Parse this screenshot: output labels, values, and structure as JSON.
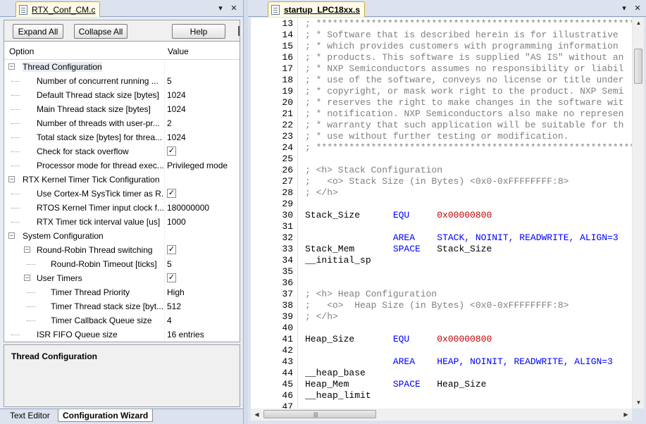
{
  "left": {
    "tab_title": "RTX_Conf_CM.c",
    "pin_glyph": "▾",
    "close_glyph": "✕",
    "toolbar": {
      "expand_all": "Expand All",
      "collapse_all": "Collapse All",
      "help": "Help"
    },
    "columns": {
      "option": "Option",
      "value": "Value"
    },
    "tree": [
      {
        "label": "Thread Configuration",
        "value": "",
        "level": 0,
        "expander": "−"
      },
      {
        "label": "Number of concurrent running ...",
        "value": "5",
        "level": 1
      },
      {
        "label": "Default Thread stack size [bytes]",
        "value": "1024",
        "level": 1
      },
      {
        "label": "Main Thread stack size [bytes]",
        "value": "1024",
        "level": 1
      },
      {
        "label": "Number of threads with user-pr...",
        "value": "2",
        "level": 1
      },
      {
        "label": "Total stack size [bytes] for threa...",
        "value": "1024",
        "level": 1
      },
      {
        "label": "Check for stack overflow",
        "check": "✓",
        "level": 1
      },
      {
        "label": "Processor mode for thread exec...",
        "value": "Privileged mode",
        "level": 1
      },
      {
        "label": "RTX Kernel Timer Tick Configuration",
        "value": "",
        "level": 0,
        "expander": "−"
      },
      {
        "label": "Use Cortex-M SysTick timer as R...",
        "check": "✓",
        "level": 1
      },
      {
        "label": "RTOS Kernel Timer input clock f...",
        "value": "180000000",
        "level": 1
      },
      {
        "label": "RTX Timer tick interval value [us]",
        "value": "1000",
        "level": 1
      },
      {
        "label": "System Configuration",
        "value": "",
        "level": 0,
        "expander": "−"
      },
      {
        "label": "Round-Robin Thread switching",
        "check": "✓",
        "level": 1,
        "expander": "−"
      },
      {
        "label": "Round-Robin Timeout [ticks]",
        "value": "5",
        "level": 2
      },
      {
        "label": "User Timers",
        "check": "✓",
        "level": 1,
        "expander": "−"
      },
      {
        "label": "Timer Thread Priority",
        "value": "High",
        "level": 2
      },
      {
        "label": "Timer Thread stack size [byt...",
        "value": "512",
        "level": 2
      },
      {
        "label": "Timer Callback Queue size",
        "value": "4",
        "level": 2
      },
      {
        "label": "ISR FIFO Queue size",
        "value": "16 entries",
        "level": 1
      }
    ],
    "description_title": "Thread Configuration",
    "bottom_tabs": {
      "text_editor": "Text Editor",
      "config_wizard": "Configuration Wizard"
    }
  },
  "right": {
    "tab_title": "startup_LPC18xx.s",
    "pin_glyph": "▾",
    "close_glyph": "✕",
    "line_numbers": [
      "13",
      "14",
      "15",
      "16",
      "17",
      "18",
      "19",
      "20",
      "21",
      "22",
      "23",
      "24",
      "25",
      "26",
      "27",
      "28",
      "29",
      "30",
      "31",
      "32",
      "33",
      "34",
      "35",
      "36",
      "37",
      "38",
      "39",
      "40",
      "41",
      "42",
      "43",
      "44",
      "45",
      "46",
      "47"
    ],
    "code": [
      [
        {
          "t": "; ****************************************************************",
          "c": "cm"
        }
      ],
      [
        {
          "t": "; * Software that is described herein is for illustrative",
          "c": "cm"
        }
      ],
      [
        {
          "t": "; * which provides customers with programming information",
          "c": "cm"
        }
      ],
      [
        {
          "t": "; * products. This software is supplied \"AS IS\" without an",
          "c": "cm"
        }
      ],
      [
        {
          "t": "; * NXP Semiconductors assumes no responsibility or liabil",
          "c": "cm"
        }
      ],
      [
        {
          "t": "; * use of the software, conveys no license or title under",
          "c": "cm"
        }
      ],
      [
        {
          "t": "; * copyright, or mask work right to the product. NXP Semi",
          "c": "cm"
        }
      ],
      [
        {
          "t": "; * reserves the right to make changes in the software wit",
          "c": "cm"
        }
      ],
      [
        {
          "t": "; * notification. NXP Semiconductors also make no represen",
          "c": "cm"
        }
      ],
      [
        {
          "t": "; * warranty that such application will be suitable for th",
          "c": "cm"
        }
      ],
      [
        {
          "t": "; * use without further testing or modification.",
          "c": "cm"
        }
      ],
      [
        {
          "t": "; ****************************************************************",
          "c": "cm"
        }
      ],
      [],
      [
        {
          "t": "; <h> Stack Configuration",
          "c": "cm"
        }
      ],
      [
        {
          "t": ";   <o> Stack Size (in Bytes) <0x0-0xFFFFFFFF:8>",
          "c": "cm"
        }
      ],
      [
        {
          "t": "; </h>",
          "c": "cm"
        }
      ],
      [],
      [
        {
          "t": "Stack_Size      ",
          "c": "id"
        },
        {
          "t": "EQU",
          "c": "kw"
        },
        {
          "t": "     ",
          "c": "id"
        },
        {
          "t": "0x00000800",
          "c": "num"
        }
      ],
      [],
      [
        {
          "t": "                ",
          "c": "id"
        },
        {
          "t": "AREA",
          "c": "kw"
        },
        {
          "t": "    ",
          "c": "id"
        },
        {
          "t": "STACK, NOINIT, READWRITE, ALIGN=3",
          "c": "kw"
        }
      ],
      [
        {
          "t": "Stack_Mem       ",
          "c": "id"
        },
        {
          "t": "SPACE",
          "c": "kw"
        },
        {
          "t": "   Stack_Size",
          "c": "id"
        }
      ],
      [
        {
          "t": "__initial_sp",
          "c": "id"
        }
      ],
      [],
      [],
      [
        {
          "t": "; <h> Heap Configuration",
          "c": "cm"
        }
      ],
      [
        {
          "t": ";   <o>  Heap Size (in Bytes) <0x0-0xFFFFFFFF:8>",
          "c": "cm"
        }
      ],
      [
        {
          "t": "; </h>",
          "c": "cm"
        }
      ],
      [],
      [
        {
          "t": "Heap_Size       ",
          "c": "id"
        },
        {
          "t": "EQU",
          "c": "kw"
        },
        {
          "t": "     ",
          "c": "id"
        },
        {
          "t": "0x00000800",
          "c": "num"
        }
      ],
      [],
      [
        {
          "t": "                ",
          "c": "id"
        },
        {
          "t": "AREA",
          "c": "kw"
        },
        {
          "t": "    ",
          "c": "id"
        },
        {
          "t": "HEAP, NOINIT, READWRITE, ALIGN=3",
          "c": "kw"
        }
      ],
      [
        {
          "t": "__heap_base",
          "c": "id"
        }
      ],
      [
        {
          "t": "Heap_Mem        ",
          "c": "id"
        },
        {
          "t": "SPACE",
          "c": "kw"
        },
        {
          "t": "   Heap_Size",
          "c": "id"
        }
      ],
      [
        {
          "t": "__heap_limit",
          "c": "id"
        }
      ],
      []
    ],
    "scroll_up": "▲",
    "scroll_down": "▼",
    "scroll_left": "◀",
    "scroll_right": "▶",
    "grip": "|||"
  }
}
